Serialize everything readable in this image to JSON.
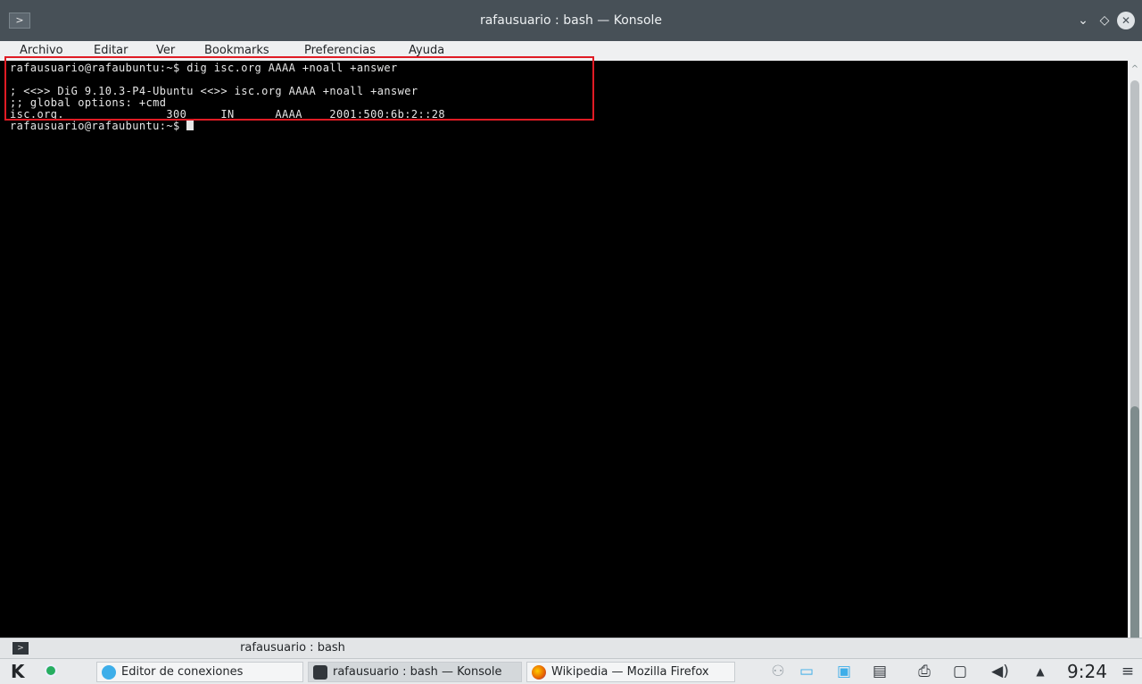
{
  "window": {
    "title": "rafausuario : bash — Konsole",
    "app_icon": ">",
    "buttons": {
      "minimize": "⌄",
      "maximize": "◇",
      "close": "✕"
    }
  },
  "menubar": [
    "Archivo",
    "Editar",
    "Ver",
    "Bookmarks",
    "Preferencias",
    "Ayuda"
  ],
  "terminal": {
    "lines": [
      "rafausuario@rafaubuntu:~$ dig isc.org AAAA +noall +answer",
      "",
      "; <<>> DiG 9.10.3-P4-Ubuntu <<>> isc.org AAAA +noall +answer",
      ";; global options: +cmd",
      "isc.org.               300     IN      AAAA    2001:500:6b:2::28",
      "rafausuario@rafaubuntu:~$ "
    ],
    "fg_color": "#e6e6e6",
    "highlight_color": "#e01b24"
  },
  "scrollbar": {
    "up_arrow": "^",
    "down_arrow": "⌄"
  },
  "tabs": {
    "active_label": "rafausuario : bash",
    "icon": ">"
  },
  "taskbar": {
    "logo": "K",
    "tasks": [
      {
        "label": "Editor de conexiones",
        "icon_color": "#3daee9"
      },
      {
        "label": "rafausuario : bash — Konsole",
        "icon_color": "#31363b"
      },
      {
        "label": "Wikipedia — Mozilla Firefox",
        "icon_color": "#e66000"
      }
    ],
    "tray_icons": [
      "user-icon",
      "monitor-icon",
      "network-icon",
      "clipboard-icon",
      "printer-icon",
      "device-icon",
      "volume-icon"
    ],
    "tray_glyphs": {
      "user": "⚇",
      "monitor": "▭",
      "network": "▣",
      "clipboard": "▤",
      "printer": "⎙",
      "device": "▢",
      "volume": "◀)"
    },
    "expand": "▲",
    "clock": "9:24",
    "menu": "≡"
  }
}
